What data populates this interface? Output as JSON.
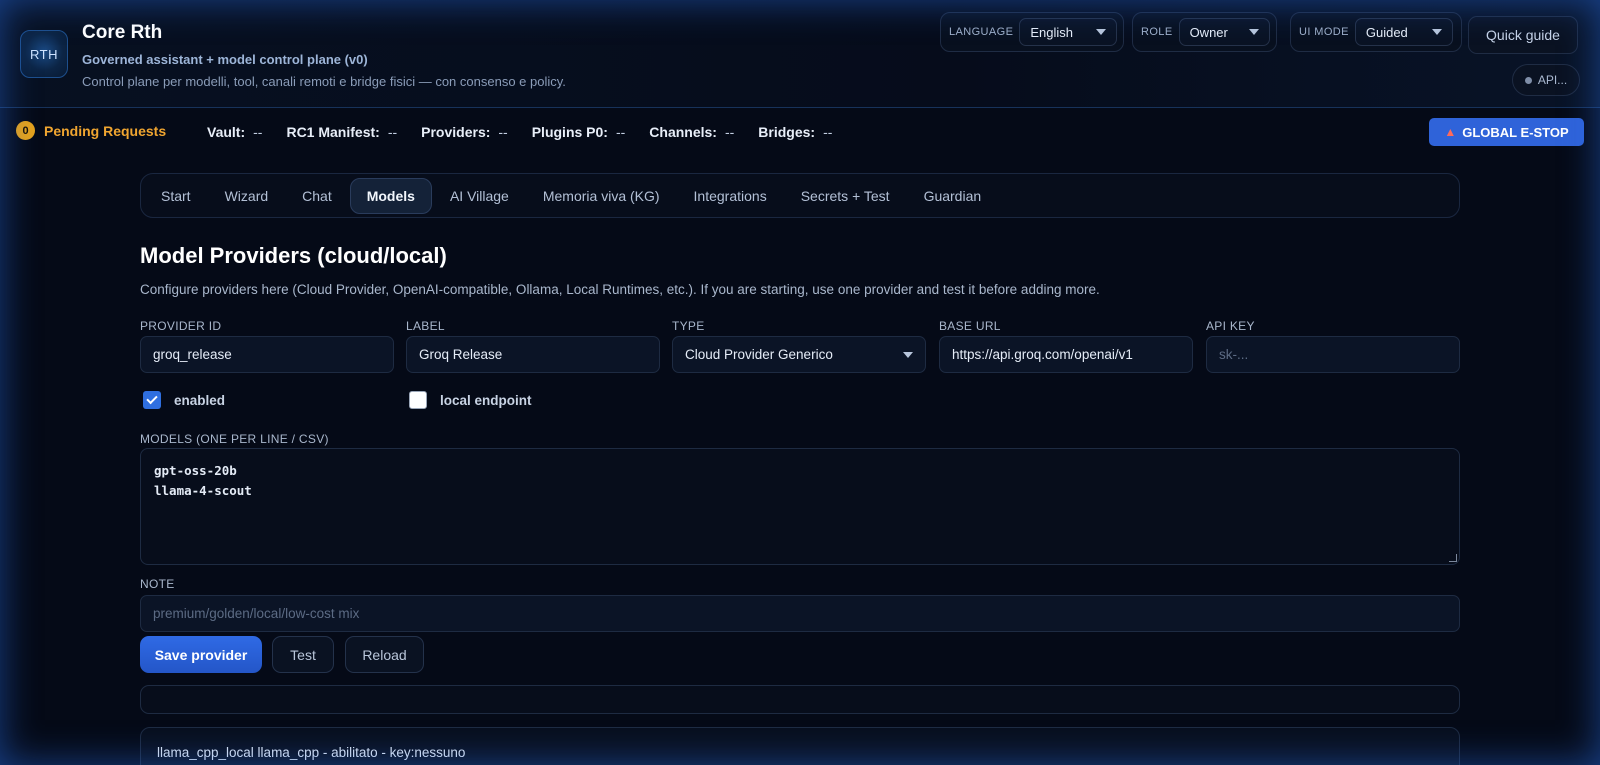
{
  "brand": {
    "logo_text": "RTH",
    "title": "Core Rth",
    "subtitle": "Governed assistant + model control plane (v0)",
    "description": "Control plane per modelli, tool, canali remoti e bridge fisici — con consenso e policy."
  },
  "controls": {
    "language": {
      "label": "LANGUAGE",
      "value": "English"
    },
    "role": {
      "label": "ROLE",
      "value": "Owner"
    },
    "ui_mode": {
      "label": "UI MODE",
      "value": "Guided"
    },
    "quick_guide": "Quick guide",
    "api_status": "API..."
  },
  "status": {
    "pending_count": "0",
    "pending_label": "Pending Requests",
    "items": [
      {
        "key": "Vault:",
        "value": "--"
      },
      {
        "key": "RC1 Manifest:",
        "value": "--"
      },
      {
        "key": "Providers:",
        "value": "--"
      },
      {
        "key": "Plugins P0:",
        "value": "--"
      },
      {
        "key": "Channels:",
        "value": "--"
      },
      {
        "key": "Bridges:",
        "value": "--"
      }
    ],
    "estop_label": "GLOBAL E-STOP",
    "estop_icon": "siren-icon"
  },
  "tabs": [
    {
      "label": "Start",
      "active": false
    },
    {
      "label": "Wizard",
      "active": false
    },
    {
      "label": "Chat",
      "active": false
    },
    {
      "label": "Models",
      "active": true
    },
    {
      "label": "AI Village",
      "active": false
    },
    {
      "label": "Memoria viva (KG)",
      "active": false
    },
    {
      "label": "Integrations",
      "active": false
    },
    {
      "label": "Secrets + Test",
      "active": false
    },
    {
      "label": "Guardian",
      "active": false
    }
  ],
  "section": {
    "title": "Model Providers (cloud/local)",
    "description": "Configure providers here (Cloud Provider, OpenAI-compatible, Ollama, Local Runtimes, etc.). If you are starting, use one provider and test it before adding more."
  },
  "form": {
    "provider_id": {
      "label": "PROVIDER ID",
      "value": "groq_release"
    },
    "label": {
      "label": "LABEL",
      "value": "Groq Release"
    },
    "type": {
      "label": "TYPE",
      "value": "Cloud Provider Generico"
    },
    "base_url": {
      "label": "BASE URL",
      "value": "https://api.groq.com/openai/v1"
    },
    "api_key": {
      "label": "API KEY",
      "placeholder": "sk-..."
    },
    "enabled": {
      "label": "enabled",
      "checked": true
    },
    "local_endpoint": {
      "label": "local endpoint",
      "checked": false
    },
    "models": {
      "label": "MODELS (ONE PER LINE / CSV)",
      "lines": [
        "gpt-oss-20b",
        "llama-4-scout"
      ]
    },
    "note": {
      "label": "NOTE",
      "placeholder": "premium/golden/local/low-cost mix"
    }
  },
  "actions": {
    "save": "Save provider",
    "test": "Test",
    "reload": "Reload"
  },
  "provider_list": [
    "llama_cpp_local llama_cpp - abilitato - key:nessuno"
  ],
  "colors": {
    "accent": "#2f6ae5",
    "pending": "#f0a530",
    "background": "#050a17"
  }
}
